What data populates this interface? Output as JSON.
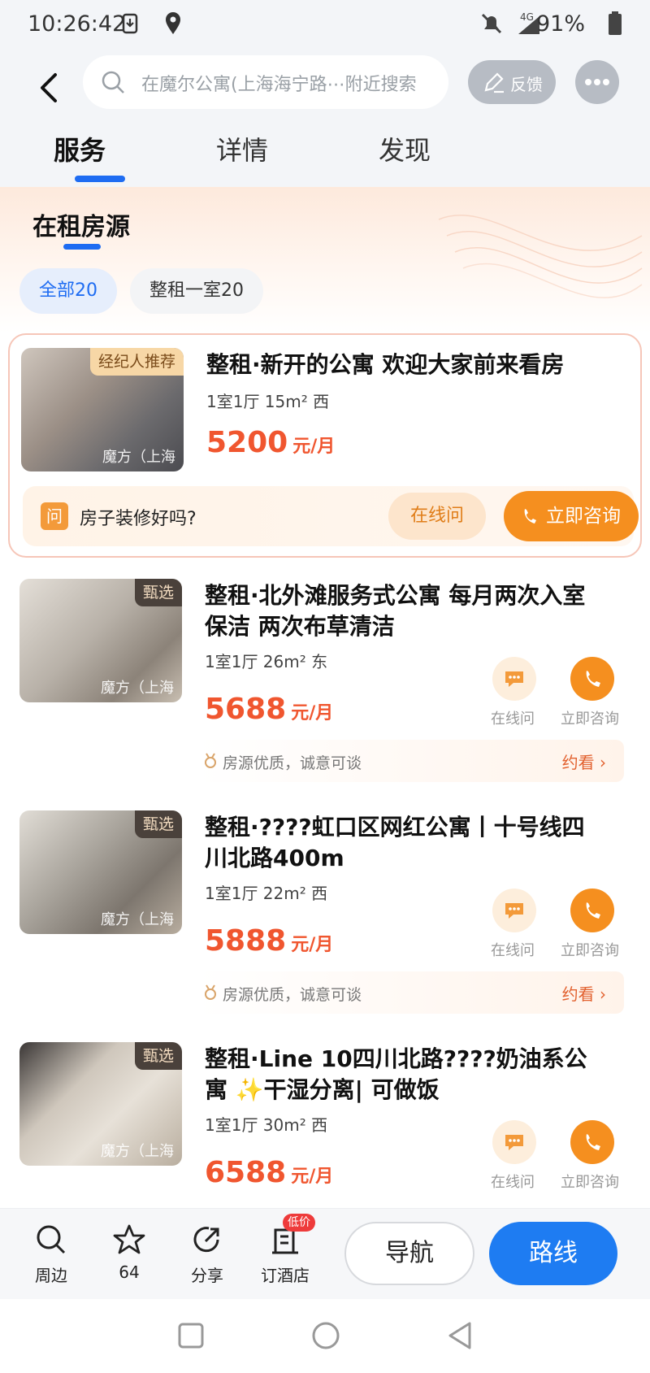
{
  "status_bar": {
    "time": "10:26:42",
    "network": "4G",
    "battery": "91%"
  },
  "header": {
    "search_placeholder": "在魔尔公寓(上海海宁路⋯附近搜索",
    "feedback_label": "反馈"
  },
  "tabs": [
    {
      "label": "服务",
      "active": true
    },
    {
      "label": "详情",
      "active": false
    },
    {
      "label": "发现",
      "active": false
    }
  ],
  "section": {
    "title": "在租房源",
    "filters": [
      {
        "label": "全部20",
        "active": true
      },
      {
        "label": "整租一室20",
        "active": false
      }
    ]
  },
  "featured": {
    "badge": "经纪人推荐",
    "watermark": "魔方（上海",
    "title": "整租·新开的公寓 欢迎大家前来看房",
    "spec": "1室1厅 15m² 西",
    "price": "5200",
    "unit": "元/月",
    "qa_icon": "问",
    "qa_text": "房子装修好吗?",
    "online_button": "在线问",
    "consult_button": "立即咨询"
  },
  "listings": [
    {
      "badge": "甄选",
      "watermark": "魔方（上海",
      "title_lines": [
        "整租·北外滩服务式公寓 每月两次入室",
        "保洁 两次布草清洁"
      ],
      "spec": "1室1厅 26m² 东",
      "price": "5688",
      "unit": "元/月",
      "online_label": "在线问",
      "consult_label": "立即咨询",
      "tip": "房源优质，诚意可谈",
      "book": "约看"
    },
    {
      "badge": "甄选",
      "watermark": "魔方（上海",
      "title_lines": [
        "整租·????虹口区网红公寓丨十号线四",
        "川北路400m"
      ],
      "spec": "1室1厅 22m² 西",
      "price": "5888",
      "unit": "元/月",
      "online_label": "在线问",
      "consult_label": "立即咨询",
      "tip": "房源优质，诚意可谈",
      "book": "约看"
    },
    {
      "badge": "甄选",
      "watermark": "魔方（上海",
      "title_lines": [
        "整租·Line 10四川北路????奶油系公",
        "寓 ✨干湿分离| 可做饭"
      ],
      "spec": "1室1厅 30m² 西",
      "price": "6588",
      "unit": "元/月",
      "online_label": "在线问",
      "consult_label": "立即咨询"
    }
  ],
  "bottom_bar": {
    "nearby": "周边",
    "favorites": "64",
    "share": "分享",
    "hotel": "订酒店",
    "hotel_badge": "低价",
    "navigate": "导航",
    "route": "路线"
  },
  "colors": {
    "accent_blue": "#1e6cf2",
    "price_red": "#f0562f",
    "orange": "#f58f1f"
  }
}
